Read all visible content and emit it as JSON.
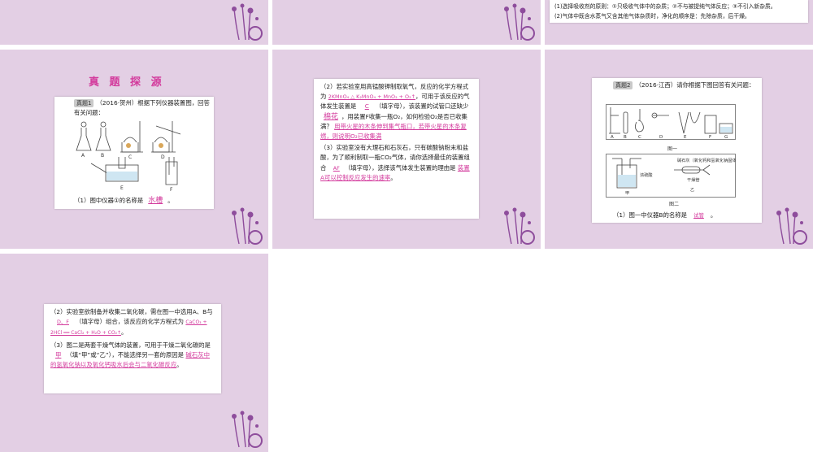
{
  "colors": {
    "slide_bg": "#e3cfe4",
    "accent": "#d33a9c"
  },
  "slide3": {
    "lines": [
      "(1)选择吸收剂的原则：①只吸收气体中的杂质；②不与被提纯气体反应；③不引入新杂质。",
      "(2)气体中既含水蒸气又含其他气体杂质时，净化的顺序是：先除杂质，后干燥。"
    ]
  },
  "slide4": {
    "heading": "真 题 探 源",
    "badge": "真题1",
    "intro": "（2016·贺州）根据下列仪器装置图，回答有关问题：",
    "fig_labels": [
      "A",
      "B",
      "C",
      "D",
      "E",
      "F"
    ],
    "q1_prefix": "（1）图中仪器①的名称是",
    "q1_answer": "水槽",
    "q1_suffix": "。"
  },
  "slide5": {
    "q2_a": "（2）若实验室用高锰酸钾制取氧气，反应的化学方程式为",
    "q2_eq": "2KMnO₄ △ K₂MnO₄ + MnO₂ + O₂↑",
    "q2_b": "，可用于该反应的气体发生装置是",
    "q2_ans1": "C",
    "q2_c": "（填字母），该装置的试管口还缺少",
    "q2_ans2": "棉花",
    "q2_d": "，用装置F收集一瓶O₂，如何检验O₂是否已收集满？",
    "q2_ans3": "用带火星的木条伸到集气瓶口，若带火星的木条复燃，则说明O₂已收集满",
    "q3_a": "（3）实验室没有大理石和石灰石，只有碳酸钠粉末和盐酸，为了顺利制取一瓶CO₂气体，请你选择最佳的装置组合",
    "q3_ans1": "AF",
    "q3_b": "（填字母），选择该气体发生装置的理由是",
    "q3_ans2": "装置A可以控制反应发生的速率",
    "q3_c": "。"
  },
  "slide6": {
    "badge": "真题2",
    "intro": "（2016·江西）请你根据下图回答有关问题：",
    "fig1_labels": [
      "A",
      "B",
      "C",
      "D",
      "E",
      "F",
      "G"
    ],
    "fig1_caption": "图一",
    "fig2_left_label": "浓硫酸",
    "fig2_right_label": "碱石灰（氧化钙和氢氧化钠固体）",
    "fig2_tube_label": "干燥管",
    "fig2_jia": "甲",
    "fig2_yi": "乙",
    "fig2_caption": "图二",
    "q1_prefix": "（1）图一中仪器B的名称是",
    "q1_answer": "试管",
    "q1_suffix": "。"
  },
  "slide7": {
    "q2_a": "（2）实验室欲制备并收集二氧化碳，需在图一中选用A、B与",
    "q2_ans1": "D、F",
    "q2_b": "（填字母）组合，该反应的化学方程式为",
    "q2_eq": "CaCO₃ + 2HCl ══ CaCl₂ + H₂O + CO₂↑",
    "q2_c": "。",
    "q3_a": "（3）图二是两套干燥气体的装置，可用于干燥二氧化碳的是",
    "q3_ans1": "甲",
    "q3_b": "（填“甲”或“乙”），不能选择另一套的原因是",
    "q3_ans2": "碱石灰中的氢氧化钠以及氧化钙吸水后会与二氧化碳反应",
    "q3_c": "。"
  }
}
